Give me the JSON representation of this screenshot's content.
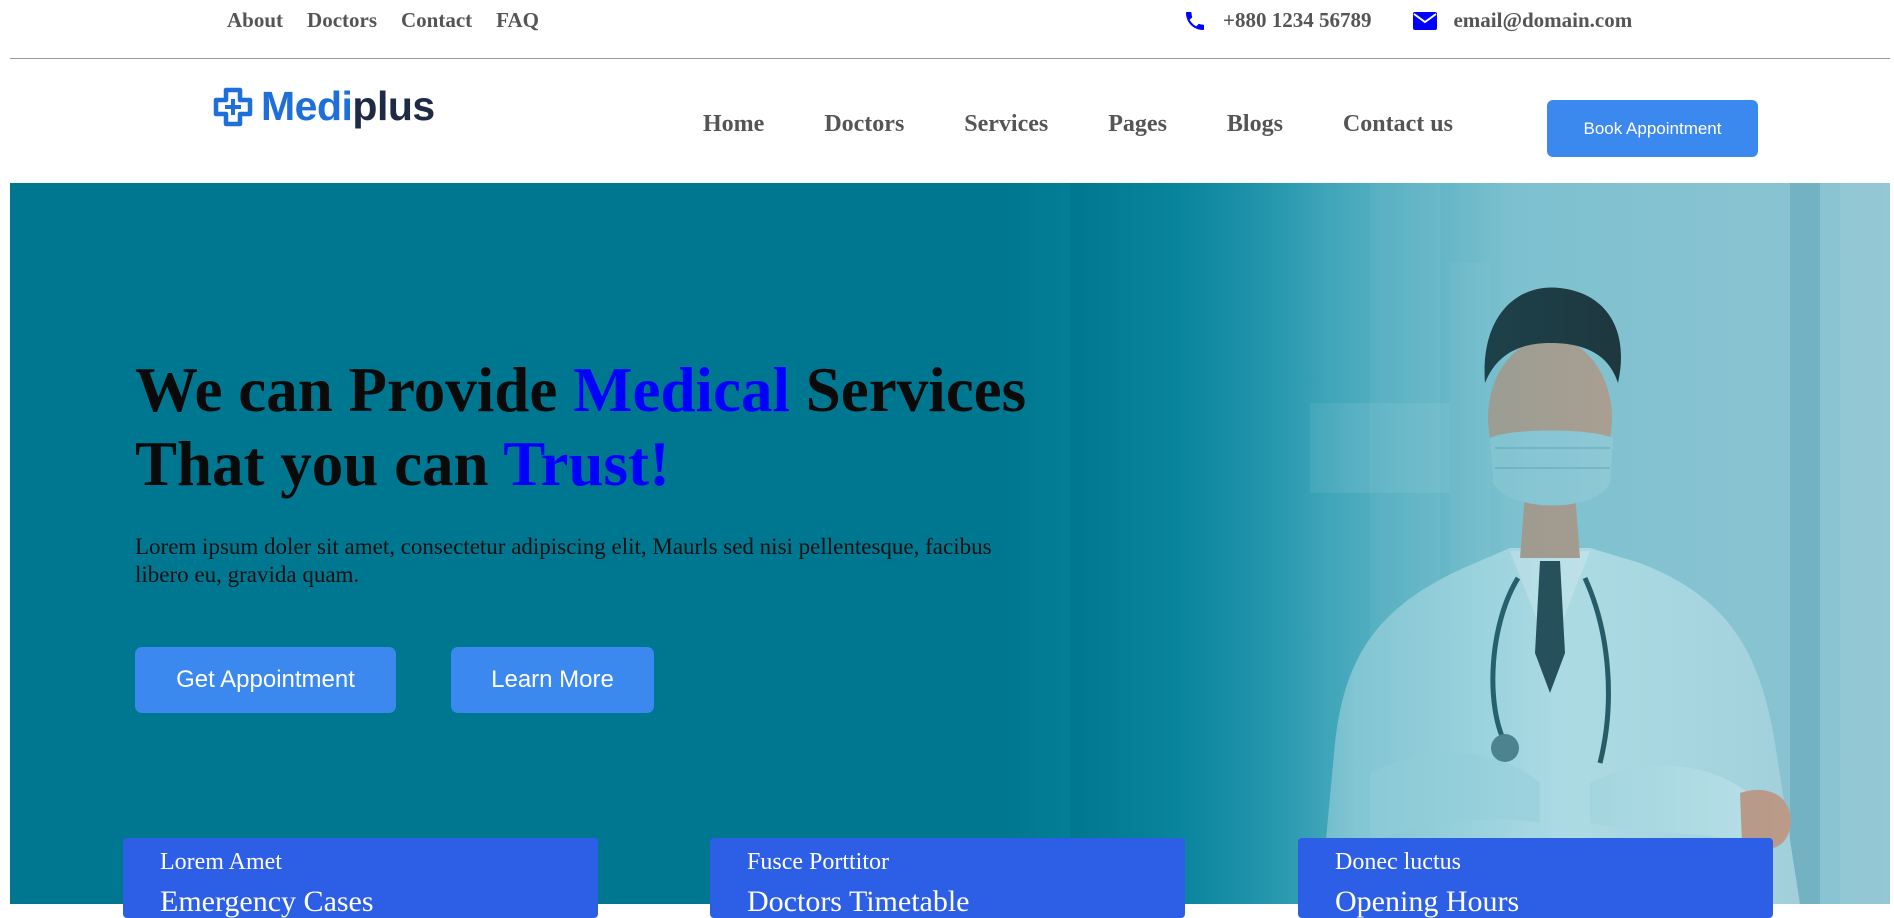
{
  "topbar": {
    "links": [
      "About",
      "Doctors",
      "Contact",
      "FAQ"
    ],
    "phone": "+880 1234 56789",
    "email": "email@domain.com",
    "icon_color": "#0000ff"
  },
  "header": {
    "logo_part1": "Medi",
    "logo_part2": "plus",
    "nav": [
      "Home",
      "Doctors",
      "Services",
      "Pages",
      "Blogs",
      "Contact us"
    ],
    "book_button": "Book Appointment"
  },
  "hero": {
    "title_a": "We can Provide ",
    "title_highlight1": "Medical",
    "title_b": " Services",
    "title_c": "That you can ",
    "title_highlight2": "Trust!",
    "description": "Lorem ipsum doler sit amet, consectetur adipiscing elit, Maurls sed nisi pellentesque, facibus libero eu, gravida quam.",
    "button_primary": "Get Appointment",
    "button_secondary": "Learn More",
    "overlay_color": "#007791"
  },
  "cards": [
    {
      "title": "Lorem Amet",
      "subtitle": "Emergency Cases"
    },
    {
      "title": "Fusce Porttitor",
      "subtitle": "Doctors Timetable"
    },
    {
      "title": "Donec luctus",
      "subtitle": "Opening Hours"
    }
  ],
  "colors": {
    "accent": "#3b89ee",
    "card": "#2d5fe6",
    "highlight": "#0000ff",
    "nav_text": "#555555"
  }
}
